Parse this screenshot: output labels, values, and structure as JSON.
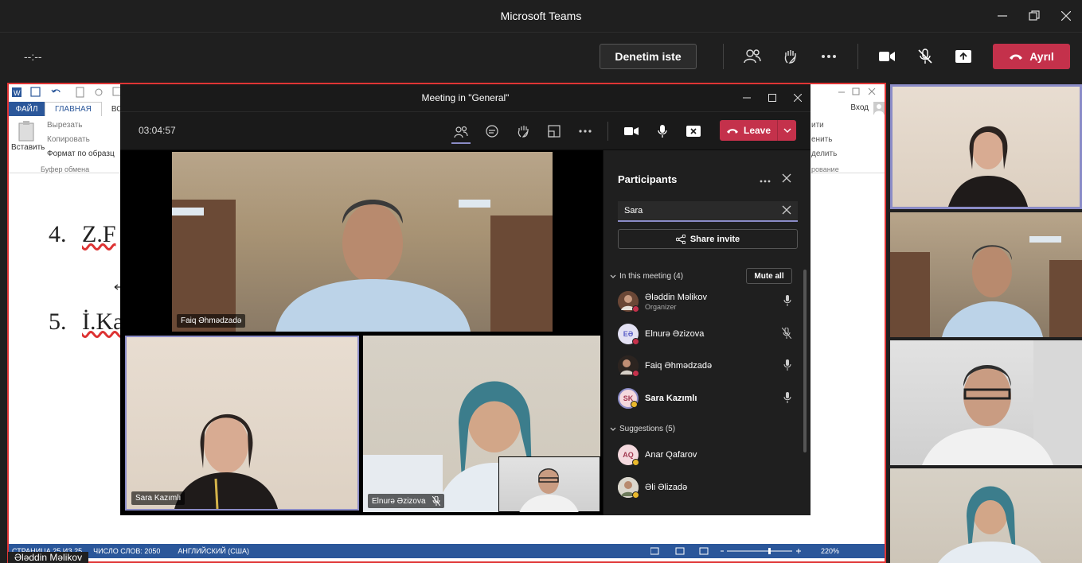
{
  "app": {
    "title": "Microsoft Teams",
    "timer": "--:--"
  },
  "toolbar": {
    "request_control": "Denetim iste",
    "leave_label": "Ayrıl"
  },
  "word": {
    "tab_file": "ФАЙЛ",
    "tab_home": "ГЛАВНАЯ",
    "tab_insert": "ВСТ",
    "paste": "Вставить",
    "cut": "Вырезать",
    "copy": "Копировать",
    "format_painter": "Формат по образц",
    "clipboard_group": "Буфер обмена",
    "signin": "Вход",
    "r1": "ити",
    "r2": "енить",
    "r3": "делить",
    "r4": "рование",
    "line4_num": "4.",
    "line4_text": "Z.F",
    "line5_num": "5.",
    "line5_text": "İ.Ka",
    "status_page": "СТРАНИЦА 25 ИЗ 25",
    "status_words": "ЧИСЛО СЛОВ: 2050",
    "status_lang": "АНГЛИЙСКИЙ (США)",
    "status_zoom": "220%"
  },
  "presenter_name": "Əlәddin Məlikov",
  "meeting": {
    "title": "Meeting in \"General\"",
    "timer": "03:04:57",
    "leave_label": "Leave",
    "tiles": [
      {
        "name": "Faiq Əhmədzadə"
      },
      {
        "name": "Sara Kazımlı"
      },
      {
        "name": "Elnurə Əzizova"
      }
    ]
  },
  "participants": {
    "title": "Participants",
    "search_value": "Sara",
    "share_invite": "Share invite",
    "in_meeting_label": "In this meeting (4)",
    "mute_all": "Mute all",
    "suggestions_label": "Suggestions (5)",
    "in_meeting": [
      {
        "name": "Əlәddin Məlikov",
        "role": "Organizer",
        "initials": "",
        "mic": "on"
      },
      {
        "name": "Elnurə Əzizova",
        "role": "",
        "initials": "EƏ",
        "mic": "off"
      },
      {
        "name": "Faiq Əhmədzadə",
        "role": "",
        "initials": "",
        "mic": "on"
      },
      {
        "name": "Sara Kazımlı",
        "role": "",
        "initials": "SK",
        "mic": "on"
      }
    ],
    "suggestions": [
      {
        "name": "Anar Qafarov",
        "initials": "AQ"
      },
      {
        "name": "Əli Əlizadə",
        "initials": ""
      }
    ]
  },
  "colors": {
    "accent": "#8b8cc7",
    "leave": "#c4314b",
    "word_blue": "#2b579a",
    "shared_border": "#e03535"
  }
}
